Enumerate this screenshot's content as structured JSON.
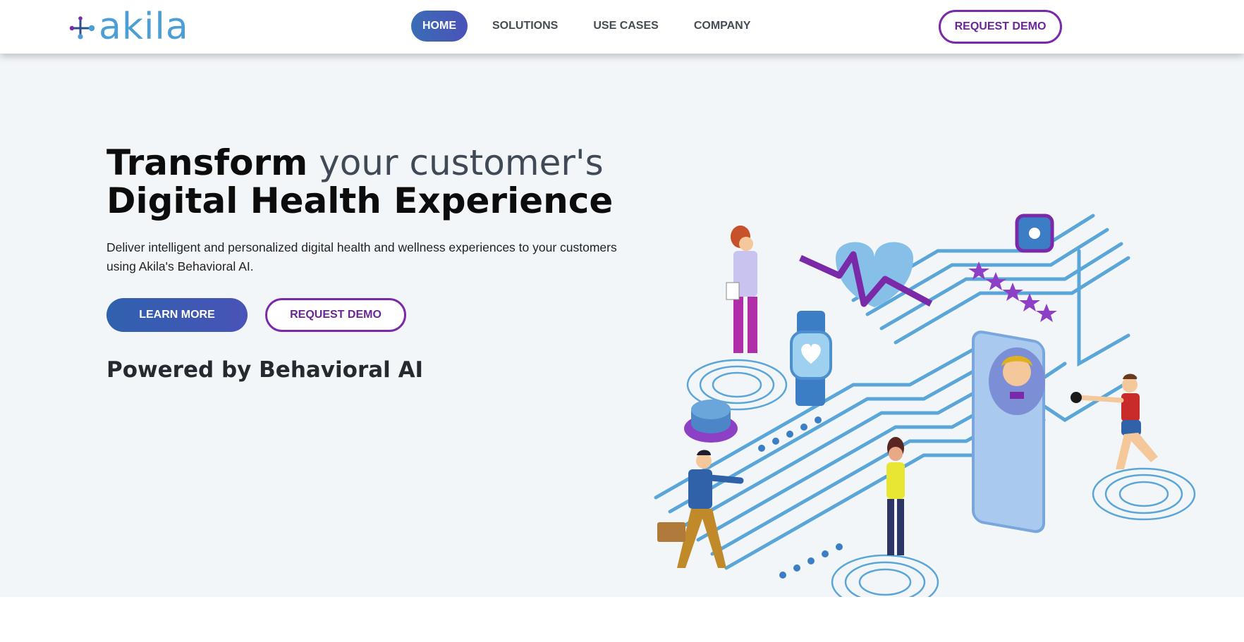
{
  "brand": {
    "name": "akila"
  },
  "nav": {
    "items": [
      {
        "label": "HOME",
        "active": true
      },
      {
        "label": "SOLUTIONS",
        "active": false
      },
      {
        "label": "USE CASES",
        "active": false
      },
      {
        "label": "COMPANY",
        "active": false
      }
    ],
    "cta_label": "REQUEST DEMO"
  },
  "hero": {
    "headline_bold_1": "Transform",
    "headline_light": " your customer's",
    "headline_bold_2": "Digital Health Experience",
    "description": "Deliver intelligent and personalized digital health and wellness experiences to your customers using Akila's Behavioral AI.",
    "learn_more_label": "LEARN MORE",
    "request_demo_label": "REQUEST DEMO",
    "powered_by": "Powered by Behavioral AI"
  },
  "colors": {
    "accent_blue": "#3b6db5",
    "accent_purple": "#7a2aa8",
    "hero_background": "#f3f6f9",
    "logo_blue": "#4c9fd4"
  },
  "icons": [
    "akila-logo-icon",
    "health-illustration"
  ]
}
